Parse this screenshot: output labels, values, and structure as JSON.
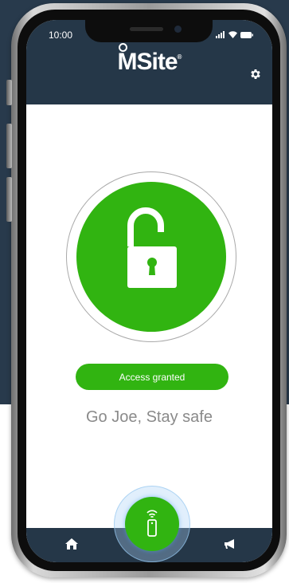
{
  "status_bar": {
    "time": "10:00"
  },
  "header": {
    "logo_text": "MSite",
    "logo_mark": "®",
    "settings_icon": "gear-icon"
  },
  "lock": {
    "state": "unlocked",
    "icon": "open-padlock-icon",
    "color": "#31b411"
  },
  "access": {
    "status_text": "Access granted",
    "color": "#31b411"
  },
  "greeting": {
    "text": "Go Joe, Stay safe"
  },
  "bottom_nav": {
    "home_icon": "home-icon",
    "action_icon": "remote-fob-icon",
    "announce_icon": "megaphone-icon",
    "background": "#253748"
  }
}
